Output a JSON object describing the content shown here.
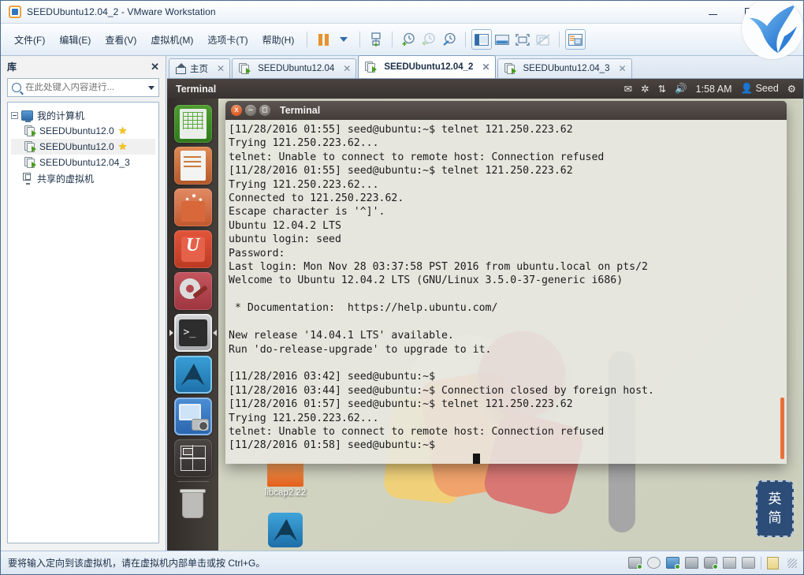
{
  "window": {
    "title": "SEEDUbuntu12.04_2 - VMware Workstation",
    "app_icon": "vmware-icon",
    "minimize_label": "—",
    "maximize_label": "□",
    "close_label": "✕"
  },
  "menubar": {
    "items": [
      {
        "label": "文件(F)",
        "name": "menu-file"
      },
      {
        "label": "编辑(E)",
        "name": "menu-edit"
      },
      {
        "label": "查看(V)",
        "name": "menu-view"
      },
      {
        "label": "虚拟机(M)",
        "name": "menu-vm"
      },
      {
        "label": "选项卡(T)",
        "name": "menu-tabs"
      },
      {
        "label": "帮助(H)",
        "name": "menu-help"
      }
    ],
    "toolbar": [
      {
        "name": "pause-button",
        "icon": "pause-icon"
      },
      {
        "name": "pause-dropdown",
        "icon": "chevron-down-icon"
      },
      {
        "name": "snapshot-take-button",
        "icon": "snapshot-icon"
      },
      {
        "name": "snapshot-new-button",
        "icon": "clock-plus-icon"
      },
      {
        "name": "snapshot-revert-button",
        "icon": "clock-back-icon"
      },
      {
        "name": "snapshot-manager-button",
        "icon": "clock-wrench-icon"
      },
      {
        "name": "show-library-button",
        "icon": "sidebar-panel-icon"
      },
      {
        "name": "show-thumbnail-bar-button",
        "icon": "thumbnail-bar-icon"
      },
      {
        "name": "fullscreen-button",
        "icon": "fullscreen-icon"
      },
      {
        "name": "unity-mode-button",
        "icon": "unity-icon"
      },
      {
        "name": "console-view-button",
        "icon": "console-view-icon"
      }
    ]
  },
  "library": {
    "title": "库",
    "close_label": "✕",
    "search": {
      "placeholder": "在此处键入内容进行...",
      "value": "",
      "icon": "search-icon",
      "dropdown_icon": "chevron-down-icon"
    },
    "tree": [
      {
        "label": "我的计算机",
        "icon": "my-computer-icon",
        "level": 0,
        "star": false,
        "selected": false
      },
      {
        "label": "SEEDUbuntu12.0",
        "icon": "vm-icon",
        "level": 1,
        "star": true,
        "selected": false
      },
      {
        "label": "SEEDUbuntu12.0",
        "icon": "vm-icon",
        "level": 1,
        "star": true,
        "selected": true
      },
      {
        "label": "SEEDUbuntu12.04_3",
        "icon": "vm-icon",
        "level": 1,
        "star": false,
        "selected": false
      },
      {
        "label": "共享的虚拟机",
        "icon": "shared-vms-icon",
        "level": 0,
        "star": false,
        "selected": false
      }
    ]
  },
  "tabs": [
    {
      "label": "主页",
      "icon": "home-icon",
      "active": false,
      "close": "✕"
    },
    {
      "label": "SEEDUbuntu12.04",
      "icon": "vm-icon",
      "active": false,
      "close": "✕"
    },
    {
      "label": "SEEDUbuntu12.04_2",
      "icon": "vm-icon",
      "active": true,
      "close": "✕"
    },
    {
      "label": "SEEDUbuntu12.04_3",
      "icon": "vm-icon",
      "active": false,
      "close": "✕"
    }
  ],
  "guest": {
    "panel": {
      "title": "Terminal",
      "clock": "1:58 AM",
      "user": "Seed",
      "indicators": [
        "mail-icon",
        "bluetooth-icon",
        "network-icon",
        "volume-icon",
        "gear-icon"
      ]
    },
    "launcher": [
      {
        "name": "launcher-item-libreoffice-calc",
        "icon": "spreadsheet-icon"
      },
      {
        "name": "launcher-item-libreoffice-impress",
        "icon": "presentation-icon"
      },
      {
        "name": "launcher-item-software-center",
        "icon": "shopping-bag-icon"
      },
      {
        "name": "launcher-item-ubuntu-one",
        "icon": "ubuntu-u-icon"
      },
      {
        "name": "launcher-item-system-settings",
        "icon": "gear-wrench-icon"
      },
      {
        "name": "launcher-item-terminal",
        "icon": "terminal-icon"
      },
      {
        "name": "launcher-item-wireshark",
        "icon": "shark-fin-icon"
      },
      {
        "name": "launcher-item-screenshot",
        "icon": "monitor-camera-icon"
      },
      {
        "name": "launcher-item-workspace-switcher",
        "icon": "workspace-grid-icon"
      },
      {
        "name": "launcher-item-trash",
        "icon": "trash-icon"
      }
    ],
    "terminal": {
      "title": "Terminal",
      "buttons": {
        "close": "x",
        "minimize": "–",
        "maximize": "□"
      },
      "lines": "[11/28/2016 01:55] seed@ubuntu:~$ telnet 121.250.223.62\nTrying 121.250.223.62...\ntelnet: Unable to connect to remote host: Connection refused\n[11/28/2016 01:55] seed@ubuntu:~$ telnet 121.250.223.62\nTrying 121.250.223.62...\nConnected to 121.250.223.62.\nEscape character is '^]'.\nUbuntu 12.04.2 LTS\nubuntu login: seed\nPassword:\nLast login: Mon Nov 28 03:37:58 PST 2016 from ubuntu.local on pts/2\nWelcome to Ubuntu 12.04.2 LTS (GNU/Linux 3.5.0-37-generic i686)\n\n * Documentation:  https://help.ubuntu.com/\n\nNew release '14.04.1 LTS' available.\nRun 'do-release-upgrade' to upgrade to it.\n\n[11/28/2016 03:42] seed@ubuntu:~$\n[11/28/2016 03:44] seed@ubuntu:~$ Connection closed by foreign host.\n[11/28/2016 01:57] seed@ubuntu:~$ telnet 121.250.223.62\nTrying 121.250.223.62...\ntelnet: Unable to connect to remote host: Connection refused\n[11/28/2016 01:58] seed@ubuntu:~$ ",
      "annotation_color": "#e8342a"
    },
    "desktop_icons": [
      {
        "label": "libcap2.22",
        "icon": "folder-icon"
      },
      {
        "label": "",
        "icon": "wireshark-file-icon"
      }
    ],
    "ime": {
      "line1": "英",
      "line2": "简"
    }
  },
  "statusbar": {
    "message": "要将输入定向到该虚拟机，请在虚拟机内部单击或按 Ctrl+G。",
    "icons": [
      {
        "name": "status-icon-harddisk",
        "icon": "hdd-icon"
      },
      {
        "name": "status-icon-cdrom",
        "icon": "cd-icon"
      },
      {
        "name": "status-icon-network",
        "icon": "network-icon"
      },
      {
        "name": "status-icon-printer",
        "icon": "printer-icon"
      },
      {
        "name": "status-icon-sound",
        "icon": "sound-icon"
      },
      {
        "name": "status-icon-usb",
        "icon": "usb-icon"
      },
      {
        "name": "status-icon-camera",
        "icon": "camera-icon"
      },
      {
        "name": "status-icon-message",
        "icon": "note-icon"
      }
    ]
  },
  "colors": {
    "accent": "#2f6ca8",
    "vm_orange": "#e8922e",
    "terminal_bg": "#e8e8e2",
    "annotation_red": "#e8342a",
    "scrollbar_orange": "#e8713a"
  }
}
